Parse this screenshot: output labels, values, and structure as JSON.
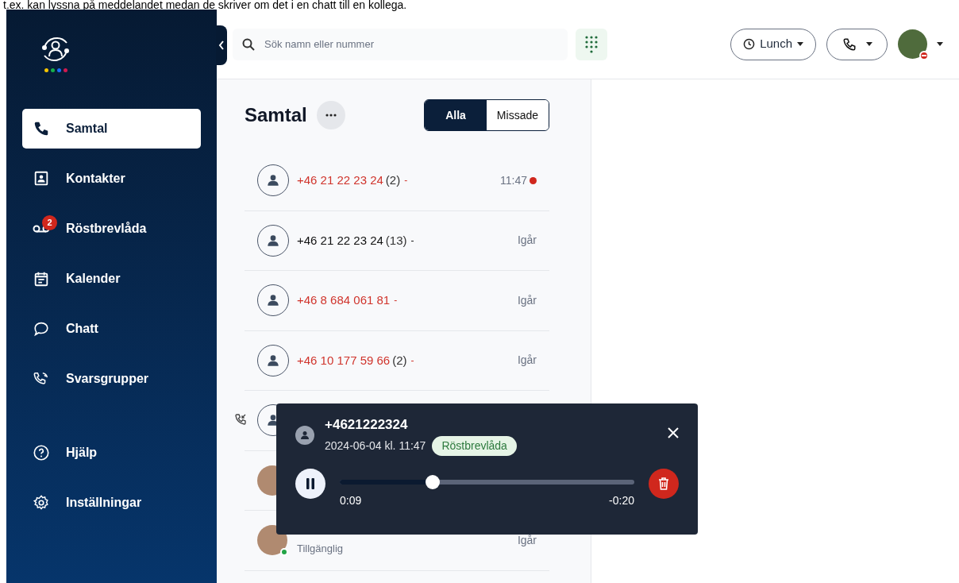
{
  "caption": "t.ex. kan lyssna på meddelandet medan de skriver om det i en chatt till en kollega.",
  "sidebar": {
    "items": [
      {
        "label": "Samtal",
        "selected": true
      },
      {
        "label": "Kontakter",
        "selected": false
      },
      {
        "label": "Röstbrevlåda",
        "selected": false,
        "badge": "2"
      },
      {
        "label": "Kalender",
        "selected": false
      },
      {
        "label": "Chatt",
        "selected": false
      },
      {
        "label": "Svarsgrupper",
        "selected": false
      }
    ],
    "bottom_items": [
      {
        "label": "Hjälp"
      },
      {
        "label": "Inställningar"
      }
    ]
  },
  "topbar": {
    "search": {
      "placeholder": "Sök namn eller nummer"
    },
    "status": {
      "label": "Lunch"
    }
  },
  "calls": {
    "title": "Samtal",
    "tabs": [
      {
        "label": "Alla",
        "selected": true
      },
      {
        "label": "Missade",
        "selected": false
      }
    ],
    "rows": [
      {
        "kind": "number",
        "number": "+46 21 22 23 24",
        "count": "(2)",
        "suffix": "-",
        "missed": true,
        "time": "11:47",
        "unread": true
      },
      {
        "kind": "number",
        "number": "+46 21 22 23 24",
        "count": "(13)",
        "suffix": "-",
        "missed": false,
        "time": "Igår",
        "unread": false
      },
      {
        "kind": "number",
        "number": "+46 8 684 061 81",
        "suffix": "-",
        "missed": true,
        "time": "Igår",
        "unread": false
      },
      {
        "kind": "number",
        "number": "+46 10 177 59 66",
        "count": "(2)",
        "suffix": "-",
        "missed": true,
        "time": "Igår",
        "unread": false
      },
      {
        "kind": "incoming"
      },
      {
        "kind": "photo"
      },
      {
        "kind": "contact",
        "presence": "Tillgänglig",
        "online": true,
        "time": "Igår"
      }
    ]
  },
  "player": {
    "number": "+4621222324",
    "date": "2024-06-04 kl. 11:47",
    "tag": "Röstbrevlåda",
    "playing": true,
    "level": 0.315,
    "elapsed": "0:09",
    "remaining": "-0:20"
  }
}
